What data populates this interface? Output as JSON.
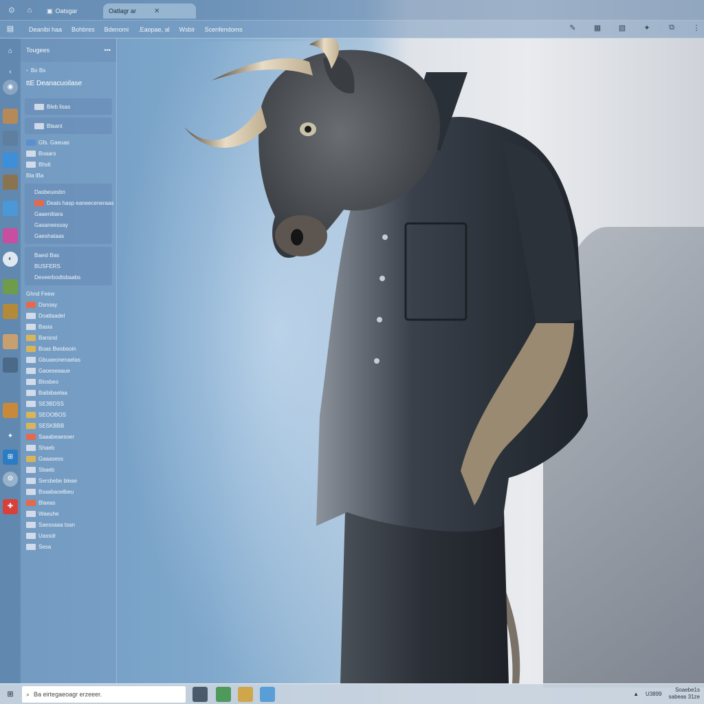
{
  "tabs": [
    {
      "label": "Oatsgar"
    },
    {
      "label": "Oatlagr ar",
      "active": true
    }
  ],
  "toolbar": {
    "address_items": [
      "Deanibi haa",
      "Bohbres",
      "Bdenomi",
      ".Eaopae, al",
      "Wsbir",
      "Scenfendoms"
    ]
  },
  "sidebar": {
    "header": "Tougees",
    "header_menu": "•••",
    "back_label": "Bo Bs",
    "title": "ttE Deanacuoilase",
    "rows": [
      {
        "label": "Bleb lisas"
      },
      {
        "label": "Blaant"
      },
      {
        "label": "Gfs. Gaeuas"
      },
      {
        "label": "Boaars"
      },
      {
        "label": "Bhslt"
      },
      {
        "label": "Bla lBa"
      },
      {
        "label": "Dasbeuesbn"
      },
      {
        "label": "Deals hasp eaneeceneraas"
      },
      {
        "label": "Gaaenitiara"
      },
      {
        "label": "Gasaneessay"
      },
      {
        "label": "Gaeshataas"
      },
      {
        "label": "Baesl Bas"
      },
      {
        "label": "BUSFERS"
      },
      {
        "label": "Deveerbodtsbaabs"
      },
      {
        "label": "Ghnd Feew"
      },
      {
        "label": "Dsnoay"
      },
      {
        "label": "Doatlaadel"
      },
      {
        "label": "Basia"
      },
      {
        "label": "Bansnd"
      },
      {
        "label": "Boas Bwsbsoin"
      },
      {
        "label": "Gbuaeonenaelas"
      },
      {
        "label": "Gaoeseaaue"
      },
      {
        "label": "Blosbeo"
      },
      {
        "label": "Baibibaelaa"
      },
      {
        "label": "SE3BDSS"
      },
      {
        "label": "SEOOBOS"
      },
      {
        "label": "SESKBBB"
      },
      {
        "label": "Saaabeaesoer"
      },
      {
        "label": "Shaeb"
      },
      {
        "label": "Gaaasess"
      },
      {
        "label": "Sbaeb"
      },
      {
        "label": "Sersbebe bleae"
      },
      {
        "label": "Bsaabaoelbeu"
      },
      {
        "label": "Blaeas"
      },
      {
        "label": "Waeuhe"
      },
      {
        "label": "Saessaaa tsan"
      },
      {
        "label": "Uassdr"
      },
      {
        "label": "Sesa"
      }
    ]
  },
  "taskbar": {
    "search_placeholder": "Ba eirtegaeoagr erzeeer.",
    "tray_label": "U3899",
    "clock_time": "Soaebe1s",
    "clock_date": "sabeas 31ze"
  },
  "icons": {
    "rail": [
      "home-icon",
      "back-icon",
      "globe-icon",
      "photo-icon",
      "mail-icon",
      "calendar-icon",
      "chart-icon",
      "star-icon",
      "settings-icon"
    ]
  },
  "colors": {
    "shirt": "#2e3440",
    "head": "#3e4349",
    "horn": "#d9cbb0",
    "wall": "#e6e8eb",
    "sky": "#7aa4cb"
  }
}
